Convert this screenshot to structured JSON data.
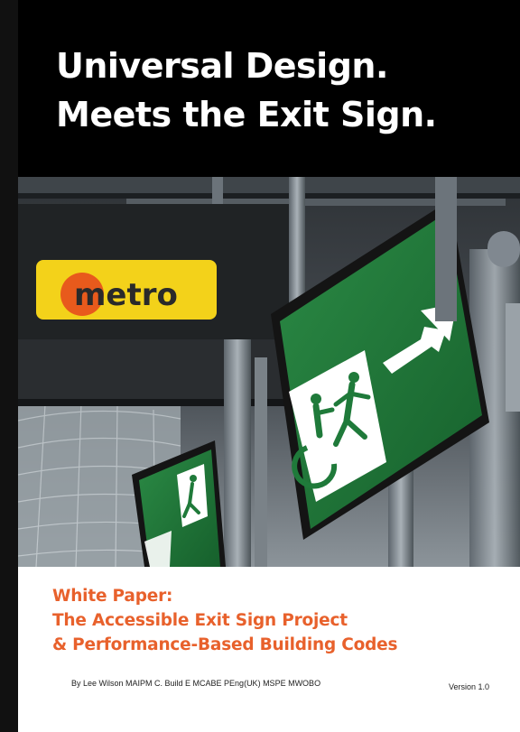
{
  "cover": {
    "headline": {
      "line1": "Universal Design.",
      "line2": "Meets the Exit Sign."
    },
    "photo": {
      "metro_logo_text": "metro",
      "colors": {
        "sign_green": "#1f7a3a",
        "metro_yellow": "#f3d21a",
        "metro_orange": "#e85a1c"
      }
    },
    "subtitle": {
      "line1": "White Paper:",
      "line2": "The Accessible Exit Sign Project",
      "line3": "& Performance-Based Building Codes"
    },
    "author": "By Lee Wilson MAIPM C. Build E MCABE PEng(UK) MSPE MWOBO",
    "version": "Version 1.0",
    "colors": {
      "headline_bg": "#000000",
      "headline_text": "#ffffff",
      "subtitle_text": "#e8612c"
    }
  }
}
